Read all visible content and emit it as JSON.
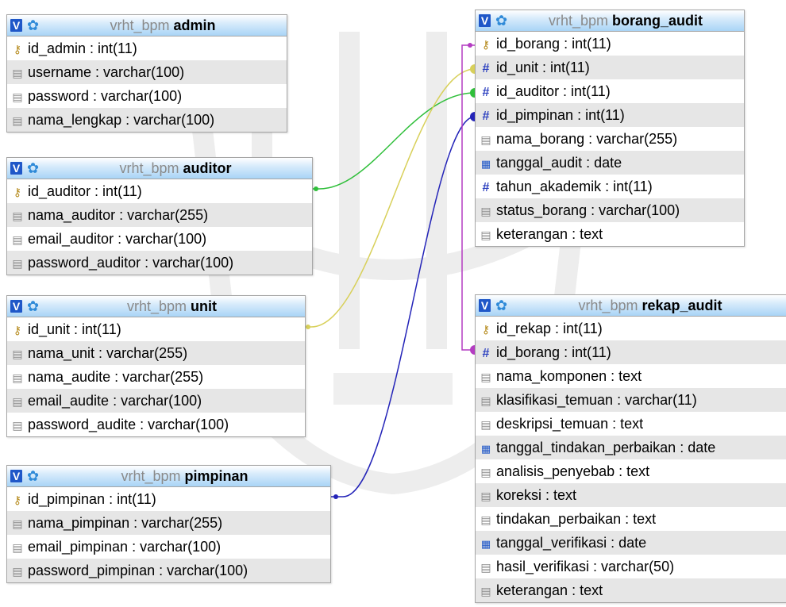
{
  "db_prefix": "vrht_bpm",
  "tables": {
    "admin": {
      "name": "admin",
      "columns": [
        {
          "icon": "key-icon",
          "label": "id_admin : int(11)"
        },
        {
          "icon": "text-field-icon",
          "label": "username : varchar(100)"
        },
        {
          "icon": "text-field-icon",
          "label": "password : varchar(100)"
        },
        {
          "icon": "text-field-icon",
          "label": "nama_lengkap : varchar(100)"
        }
      ]
    },
    "auditor": {
      "name": "auditor",
      "columns": [
        {
          "icon": "key-icon",
          "label": "id_auditor : int(11)"
        },
        {
          "icon": "text-field-icon",
          "label": "nama_auditor : varchar(255)"
        },
        {
          "icon": "text-field-icon",
          "label": "email_auditor : varchar(100)"
        },
        {
          "icon": "text-field-icon",
          "label": "password_auditor : varchar(100)"
        }
      ]
    },
    "unit": {
      "name": "unit",
      "columns": [
        {
          "icon": "key-icon",
          "label": "id_unit : int(11)"
        },
        {
          "icon": "text-field-icon",
          "label": "nama_unit : varchar(255)"
        },
        {
          "icon": "text-field-icon",
          "label": "nama_audite : varchar(255)"
        },
        {
          "icon": "text-field-icon",
          "label": "email_audite : varchar(100)"
        },
        {
          "icon": "text-field-icon",
          "label": "password_audite : varchar(100)"
        }
      ]
    },
    "pimpinan": {
      "name": "pimpinan",
      "columns": [
        {
          "icon": "key-icon",
          "label": "id_pimpinan : int(11)"
        },
        {
          "icon": "text-field-icon",
          "label": "nama_pimpinan : varchar(255)"
        },
        {
          "icon": "text-field-icon",
          "label": "email_pimpinan : varchar(100)"
        },
        {
          "icon": "text-field-icon",
          "label": "password_pimpinan : varchar(100)"
        }
      ]
    },
    "borang_audit": {
      "name": "borang_audit",
      "columns": [
        {
          "icon": "key-icon",
          "label": "id_borang : int(11)"
        },
        {
          "icon": "hash-icon",
          "label": "id_unit : int(11)"
        },
        {
          "icon": "hash-icon",
          "label": "id_auditor : int(11)"
        },
        {
          "icon": "hash-icon",
          "label": "id_pimpinan : int(11)"
        },
        {
          "icon": "text-field-icon",
          "label": "nama_borang : varchar(255)"
        },
        {
          "icon": "date-icon",
          "label": "tanggal_audit : date"
        },
        {
          "icon": "hash-icon",
          "label": "tahun_akademik : int(11)"
        },
        {
          "icon": "text-field-icon",
          "label": "status_borang : varchar(100)"
        },
        {
          "icon": "text-field-icon",
          "label": "keterangan : text"
        }
      ]
    },
    "rekap_audit": {
      "name": "rekap_audit",
      "columns": [
        {
          "icon": "key-icon",
          "label": "id_rekap : int(11)"
        },
        {
          "icon": "hash-icon",
          "label": "id_borang : int(11)"
        },
        {
          "icon": "text-field-icon",
          "label": "nama_komponen : text"
        },
        {
          "icon": "text-field-icon",
          "label": "klasifikasi_temuan : varchar(11)"
        },
        {
          "icon": "text-field-icon",
          "label": "deskripsi_temuan : text"
        },
        {
          "icon": "date-icon",
          "label": "tanggal_tindakan_perbaikan : date"
        },
        {
          "icon": "text-field-icon",
          "label": "analisis_penyebab : text"
        },
        {
          "icon": "text-field-icon",
          "label": "koreksi : text"
        },
        {
          "icon": "text-field-icon",
          "label": "tindakan_perbaikan : text"
        },
        {
          "icon": "date-icon",
          "label": "tanggal_verifikasi : date"
        },
        {
          "icon": "text-field-icon",
          "label": "hasil_verifikasi : varchar(50)"
        },
        {
          "icon": "text-field-icon",
          "label": "keterangan : text"
        }
      ]
    }
  },
  "relations": [
    {
      "from": "auditor.id_auditor",
      "to": "borang_audit.id_auditor",
      "color": "#2fbf3a"
    },
    {
      "from": "unit.id_unit",
      "to": "borang_audit.id_unit",
      "color": "#d8d05a"
    },
    {
      "from": "pimpinan.id_pimpinan",
      "to": "borang_audit.id_pimpinan",
      "color": "#2424b8"
    },
    {
      "from": "borang_audit.id_borang",
      "to": "rekap_audit.id_borang",
      "color": "#b43cc2"
    }
  ]
}
